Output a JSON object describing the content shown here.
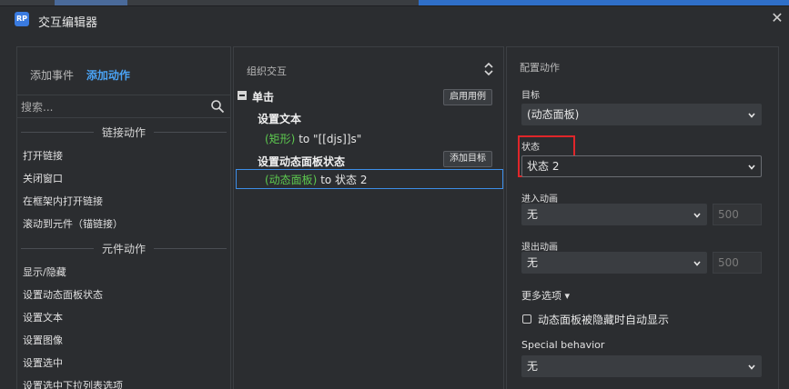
{
  "window": {
    "title": "交互编辑器",
    "app_icon_text": "RP",
    "close_glyph": "✕"
  },
  "left": {
    "tabs": [
      "添加事件",
      "添加动作"
    ],
    "search_placeholder": "搜索...",
    "sections": [
      "链接动作",
      "元件动作"
    ],
    "link_items": [
      "打开链接",
      "关闭窗口",
      "在框架内打开链接",
      "滚动到元件（锚链接）"
    ],
    "widget_items": [
      "显示/隐藏",
      "设置动态面板状态",
      "设置文本",
      "设置图像",
      "设置选中",
      "设置选中下拉列表选项"
    ]
  },
  "middle": {
    "heading": "组织交互",
    "event": "单击",
    "enable_case_button": "启用用例",
    "action1": {
      "title": "设置文本",
      "target": "(矩形)",
      "rest": " to \"[[djs]]s\""
    },
    "action2": {
      "title": "设置动态面板状态",
      "add_target_button": "添加目标",
      "target": "(动态面板)",
      "rest": " to 状态 2"
    }
  },
  "right": {
    "heading": "配置动作",
    "target_label": "目标",
    "target_value": "(动态面板)",
    "state_label": "状态",
    "state_value": "状态 2",
    "enter_anim_label": "进入动画",
    "enter_anim_value": "无",
    "enter_anim_duration": "500",
    "exit_anim_label": "退出动画",
    "exit_anim_value": "无",
    "exit_anim_duration": "500",
    "more_options": "更多选项 ▾",
    "auto_show_label": "动态面板被隐藏时自动显示",
    "special_label": "Special behavior",
    "special_value": "无",
    "highlight_color": "#e0262a",
    "accent_color": "#4aa3f5"
  }
}
